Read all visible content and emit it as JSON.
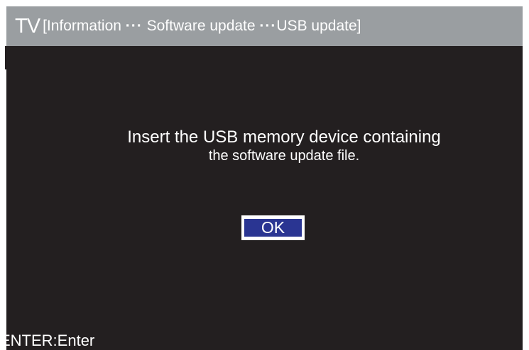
{
  "header": {
    "tv_label": "TV",
    "path_prefix": "[Information ",
    "crumbs": [
      "Software update",
      "USB update]"
    ],
    "separator": "···"
  },
  "dialog": {
    "line1": "Insert the USB memory device containing",
    "line2": "the software update file.",
    "ok_label": "OK"
  },
  "footer": {
    "hint": "ENTER:Enter"
  },
  "colors": {
    "title_bar": "#9a9ea1",
    "background": "#231f20",
    "ok_fill": "#2a3592",
    "text": "#ffffff"
  }
}
